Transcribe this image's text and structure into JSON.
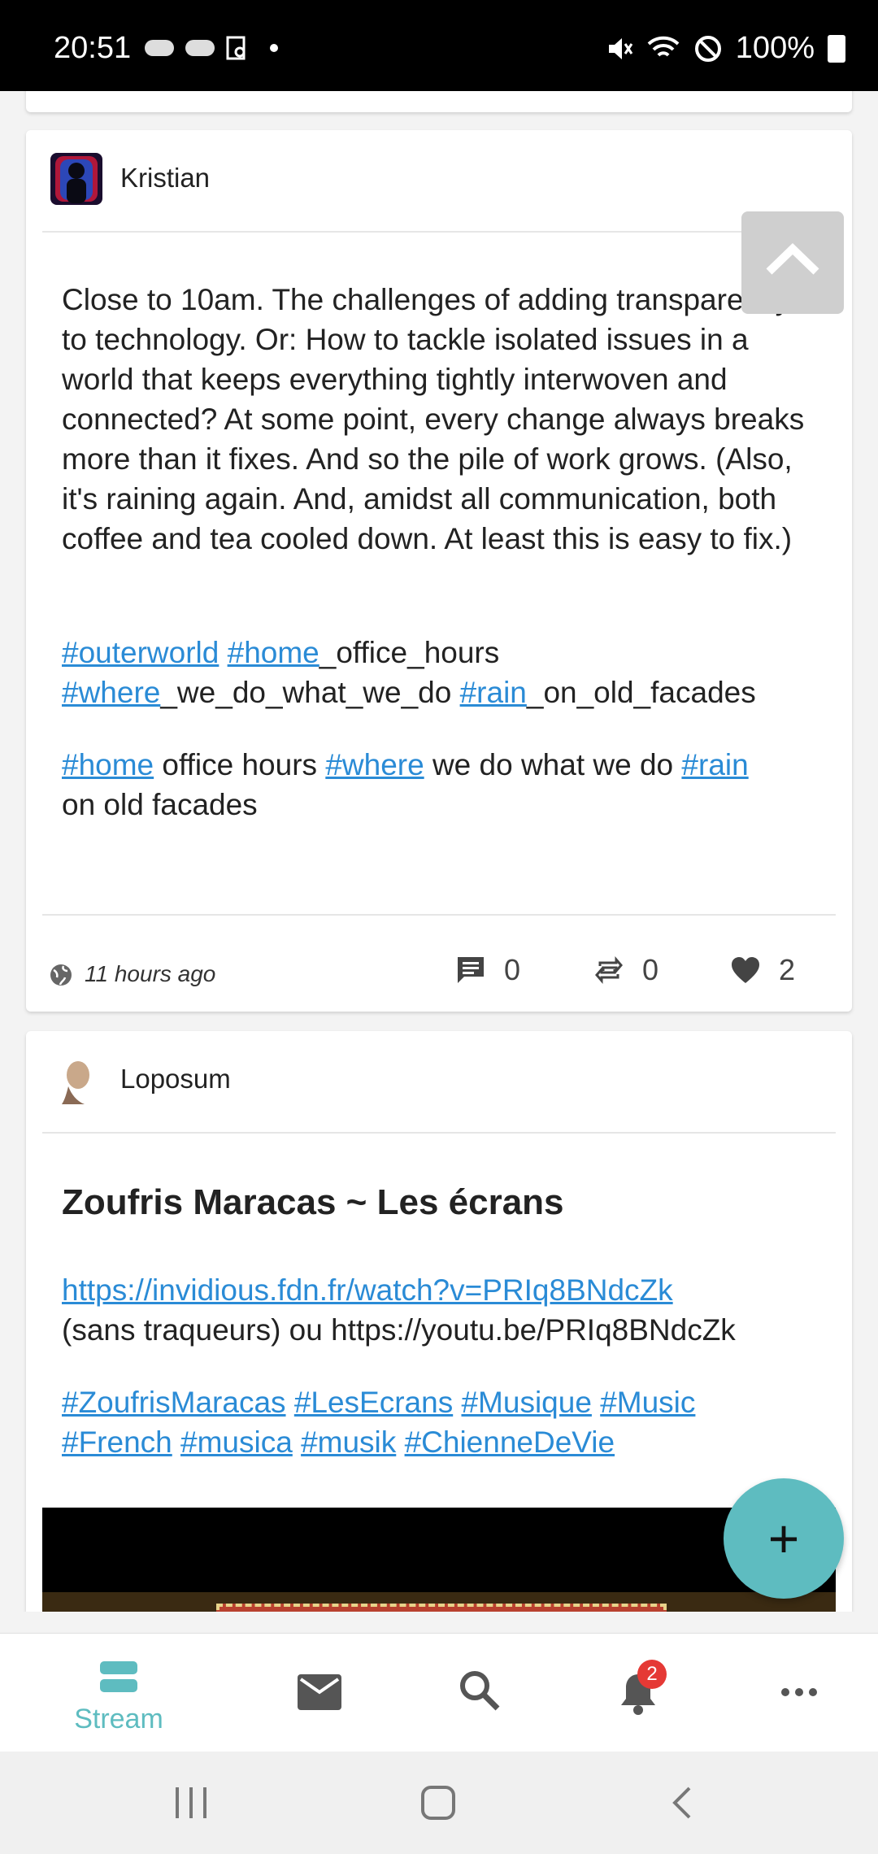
{
  "status_bar": {
    "time": "20:51",
    "battery": "100%",
    "icons": [
      "cloud-icon",
      "cloud-icon",
      "screenshot-icon",
      "dot-icon",
      "mute-icon",
      "wifi-icon",
      "blocked-icon",
      "battery-icon"
    ]
  },
  "posts": [
    {
      "author": "Kristian",
      "text": "Close to 10am. The challenges of adding transparency to technology. Or: How to tackle isolated issues in a world that keeps everything tightly interwoven and connected? At some point, every change always breaks more than it fixes. And so the pile of work grows. (Also, it's raining again. And, amidst all communication, both coffee and tea cooled down. At least this is easy to fix.)",
      "tags_line1": {
        "t1": "#outerworld",
        "t2": "#home",
        "s2": "_office_hours",
        "t3": "#where",
        "s3": "_we_do_what_we_do",
        "t4": "#rain",
        "s4": "_on_old_facades"
      },
      "tags_line2": {
        "t1": "#home",
        "s1": " office hours ",
        "t2": "#where",
        "s2": " we do what we do ",
        "t3": "#rain",
        "s3": "on old facades"
      },
      "time_ago": "11 hours ago",
      "comments": "0",
      "reshares": "0",
      "likes": "2"
    },
    {
      "author": "Loposum",
      "title": "Zoufris Maracas ~ Les écrans",
      "link": "https://invidious.fdn.fr/watch?v=PRIq8BNdcZk",
      "link_suffix": "(sans traqueurs) ou https://youtu.be/PRIq8BNdcZk",
      "tags": [
        "#ZoufrisMaracas",
        "#LesEcrans",
        "#Musique",
        "#Music",
        "#French",
        "#musica",
        "#musik",
        "#ChienneDeVie"
      ]
    }
  ],
  "fab": {
    "label": "+"
  },
  "bottom_nav": {
    "stream_label": "Stream",
    "notifications_badge": "2"
  },
  "colors": {
    "accent": "#5ebcc0",
    "link": "#2a8bd6",
    "badge": "#e53935"
  }
}
